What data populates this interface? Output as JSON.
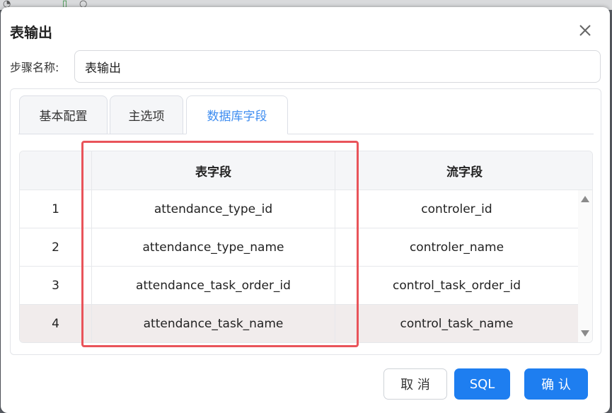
{
  "dialog": {
    "title": "表输出",
    "step_name_label": "步骤名称:",
    "step_name_value": "表输出"
  },
  "tabs": [
    {
      "label": "基本配置",
      "active": false
    },
    {
      "label": "主选项",
      "active": false
    },
    {
      "label": "数据库字段",
      "active": true
    }
  ],
  "table": {
    "headers": [
      "",
      "表字段",
      "流字段"
    ],
    "rows": [
      {
        "index": "1",
        "table_field": "attendance_type_id",
        "stream_field": "controler_id"
      },
      {
        "index": "2",
        "table_field": "attendance_type_name",
        "stream_field": "controler_name"
      },
      {
        "index": "3",
        "table_field": "attendance_task_order_id",
        "stream_field": "control_task_order_id"
      },
      {
        "index": "4",
        "table_field": "attendance_task_name",
        "stream_field": "control_task_name",
        "selected": true
      }
    ]
  },
  "buttons": {
    "cancel": "取 消",
    "sql": "SQL",
    "confirm": "确 认"
  },
  "colors": {
    "primary": "#1e7ef0",
    "active_tab_text": "#3d8cf0",
    "highlight_border": "#e9545a",
    "selected_row": "#f1ecec"
  },
  "icons": [
    "close-icon",
    "scroll-up-icon",
    "scroll-down-icon"
  ]
}
